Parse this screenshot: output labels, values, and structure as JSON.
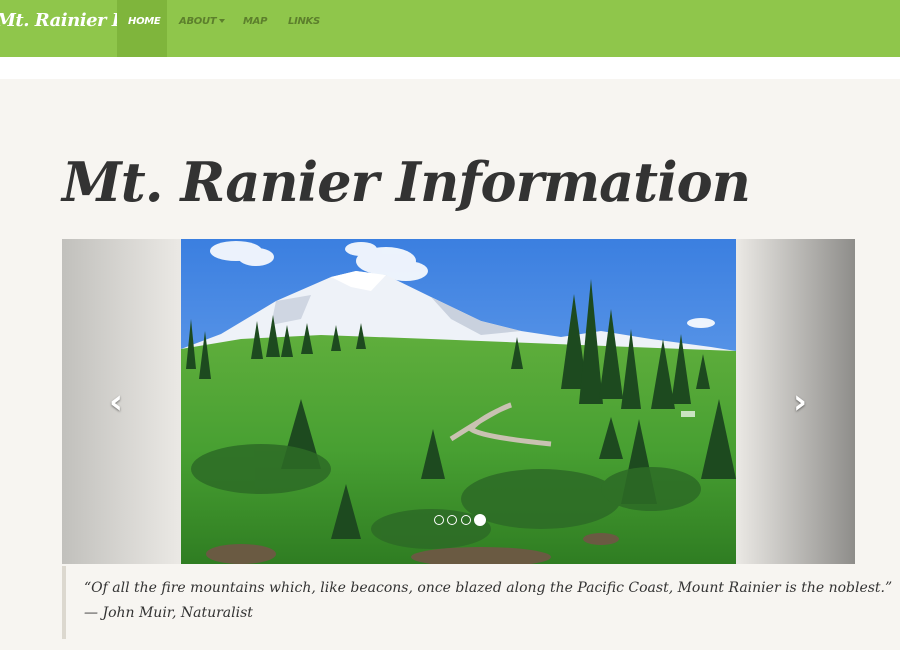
{
  "brand": "Mt. Rainier Info",
  "nav": {
    "home": "HOME",
    "about": "ABOUT",
    "map": "MAP",
    "links": "LINKS"
  },
  "page_title": "Mt. Ranier Information",
  "carousel": {
    "prev_glyph": "‹",
    "next_glyph": "›",
    "slide_count": 4,
    "active_slide_index": 4
  },
  "quote": {
    "text": "“Of all the fire mountains which, like beacons, once blazed along the Pacific Coast, Mount Rainier is the noblest.”",
    "attribution": "— John Muir, Naturalist"
  },
  "colors": {
    "navbar": "#8fc64b",
    "nav_active": "#7fb53c",
    "page_background": "#f7f5f1"
  }
}
